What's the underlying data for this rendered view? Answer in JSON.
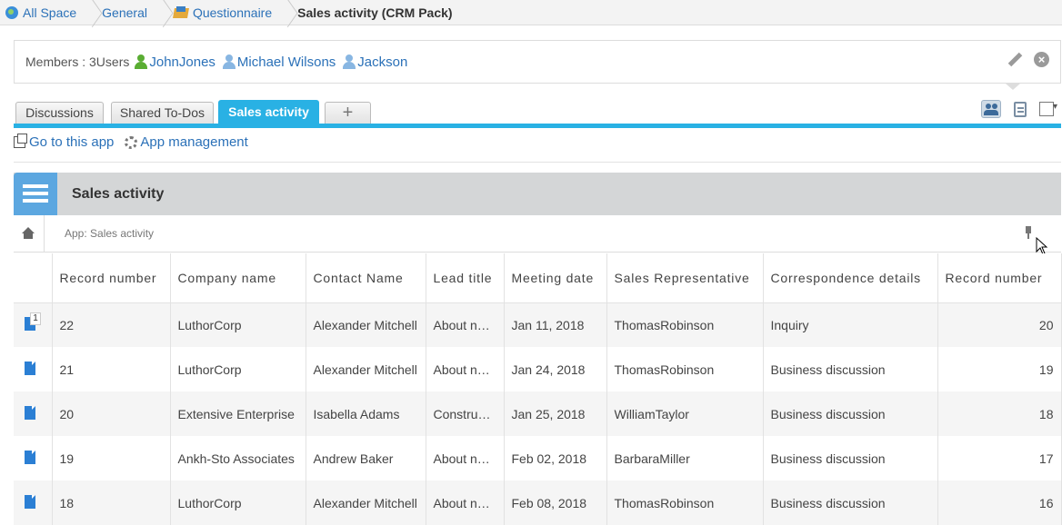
{
  "breadcrumb": [
    {
      "label": "All Space",
      "icon": "globe-icon"
    },
    {
      "label": "General"
    },
    {
      "label": "Questionnaire",
      "icon": "questionnaire-icon"
    },
    {
      "label": "Sales activity (CRM Pack)"
    }
  ],
  "members": {
    "label": "Members : 3Users",
    "users": [
      "JohnJones",
      "Michael Wilsons",
      "Jackson"
    ]
  },
  "tabs": [
    "Discussions",
    "Shared To-Dos",
    "Sales activity",
    "+"
  ],
  "links": {
    "goto": "Go to this app",
    "manage": "App management"
  },
  "app": {
    "title": "Sales activity",
    "path": "App: Sales activity"
  },
  "table": {
    "headers": [
      "Record number",
      "Company name",
      "Contact Name",
      "Lead title",
      "Meeting date",
      "Sales Representative",
      "Correspondence details",
      "Record number"
    ],
    "rows": [
      [
        "22",
        "LuthorCorp",
        "Alexander Mitchell",
        "About n…",
        "Jan 11, 2018",
        "ThomasRobinson",
        "Inquiry",
        "20"
      ],
      [
        "21",
        "LuthorCorp",
        "Alexander Mitchell",
        "About n…",
        "Jan 24, 2018",
        "ThomasRobinson",
        "Business discussion",
        "19"
      ],
      [
        "20",
        "Extensive Enterprise",
        "Isabella Adams",
        "Constru…",
        "Jan 25, 2018",
        "WilliamTaylor",
        "Business discussion",
        "18"
      ],
      [
        "19",
        "Ankh-Sto Associates",
        "Andrew Baker",
        "About n…",
        "Feb 02, 2018",
        "BarbaraMiller",
        "Business discussion",
        "17"
      ],
      [
        "18",
        "LuthorCorp",
        "Alexander Mitchell",
        "About n…",
        "Feb 08, 2018",
        "ThomasRobinson",
        "Business discussion",
        "16"
      ]
    ],
    "first_row_badge": "1"
  },
  "colors": {
    "accent": "#29b1e4",
    "link": "#2b71b8",
    "app_icon": "#5ca7e0"
  }
}
